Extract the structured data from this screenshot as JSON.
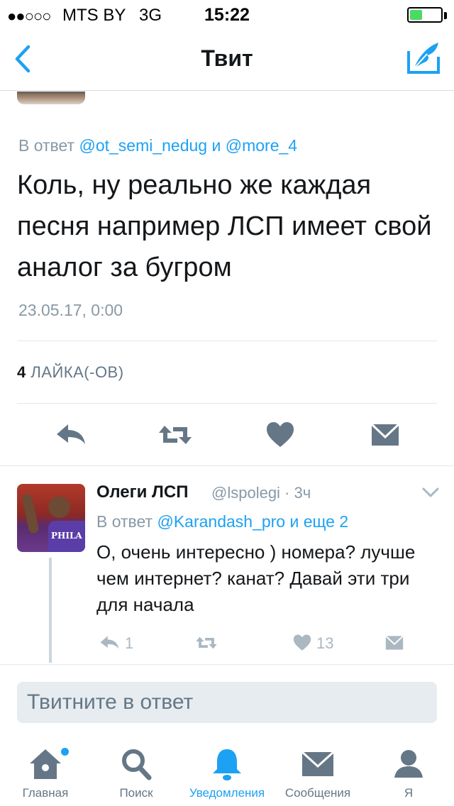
{
  "status_bar": {
    "signal": "●●○○○",
    "carrier": "MTS BY",
    "network": "3G",
    "time": "15:22",
    "battery_level": 0.4
  },
  "nav": {
    "title": "Твит",
    "back_icon": "chevron-left-icon",
    "compose_icon": "compose-quill-icon"
  },
  "tweet": {
    "reply_prefix": "В ответ",
    "reply_mention_1": "@ot_semi_nedug",
    "reply_and": "и",
    "reply_mention_2": "@more_4",
    "text": "Коль, ну реально же каждая песня например ЛСП имеет свой аналог за бугром",
    "date": "23.05.17, 0:00",
    "likes_count": "4",
    "likes_label": "ЛАЙКА(-ОВ)",
    "actions": [
      "reply-icon",
      "retweet-icon",
      "heart-icon",
      "message-icon"
    ]
  },
  "reply": {
    "name": "Олеги ЛСП",
    "handle_time": "@lspolegi · 3ч",
    "reply_prefix": "В ответ",
    "reply_mention": "@Karandash_pro и еще 2",
    "avatar_jersey_text": "PHILA",
    "text": "О, очень интересно ) номера? лучше чем интернет? канат? Давай эти три для начала",
    "reply_count": "1",
    "like_count": "13"
  },
  "composer": {
    "placeholder": "Твитните в ответ"
  },
  "tabs": [
    {
      "label": "Главная",
      "icon": "home-icon",
      "active": false,
      "badge": true
    },
    {
      "label": "Поиск",
      "icon": "search-icon",
      "active": false,
      "badge": false
    },
    {
      "label": "Уведомления",
      "icon": "bell-icon",
      "active": true,
      "badge": false
    },
    {
      "label": "Сообщения",
      "icon": "envelope-icon",
      "active": false,
      "badge": false
    },
    {
      "label": "Я",
      "icon": "profile-icon",
      "active": false,
      "badge": false
    }
  ],
  "colors": {
    "accent": "#1da1f2",
    "muted": "#8899a6",
    "icon_gray": "#657786",
    "icon_light": "#aab8c2"
  }
}
